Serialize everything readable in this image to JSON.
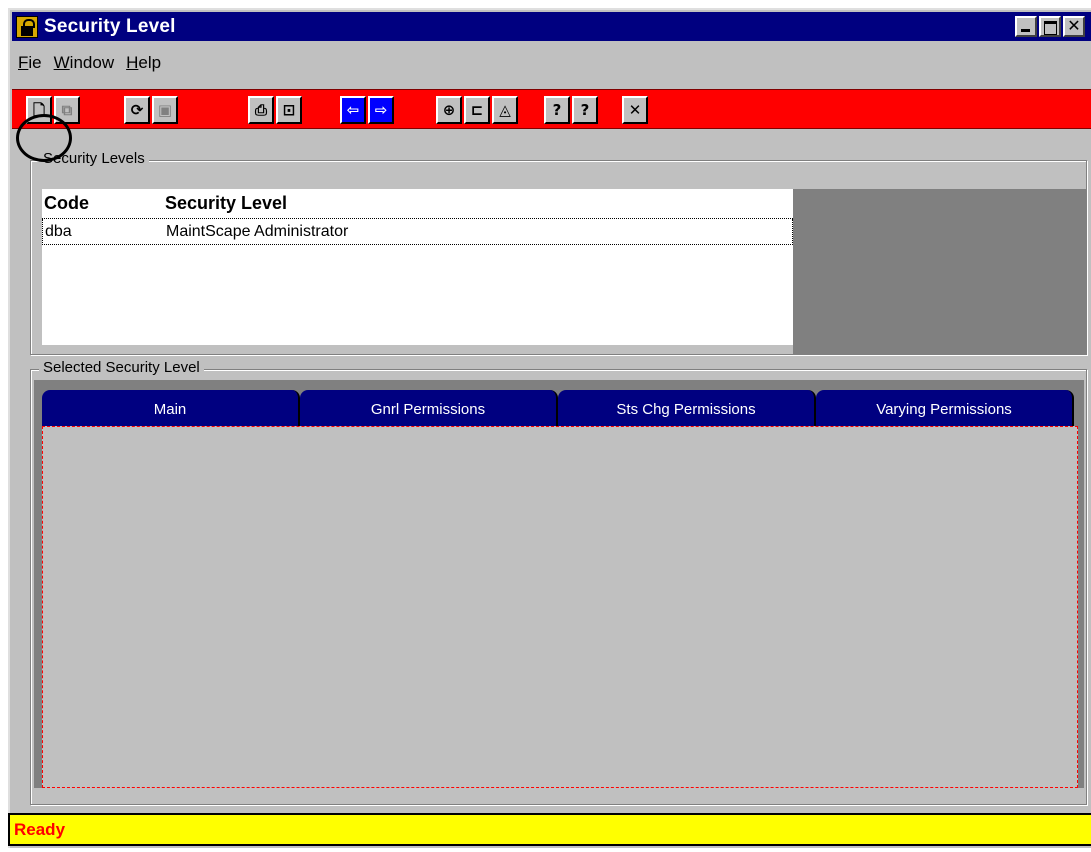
{
  "window": {
    "title": "Security Level",
    "icon": "lock-icon"
  },
  "menu": {
    "file": {
      "u": "F",
      "rest": "ie"
    },
    "window": {
      "u": "W",
      "rest": "indow"
    },
    "help": {
      "u": "H",
      "rest": "elp"
    }
  },
  "toolbar": {
    "buttons": [
      {
        "name": "new-document-icon"
      },
      {
        "name": "copy-icon"
      },
      {
        "name": "refresh-icon"
      },
      {
        "name": "save-icon"
      },
      {
        "name": "print-icon"
      },
      {
        "name": "print-preview-icon"
      },
      {
        "name": "previous-record-icon"
      },
      {
        "name": "next-record-icon"
      },
      {
        "name": "security-lock-icon"
      },
      {
        "name": "open-folder-icon"
      },
      {
        "name": "find-icon"
      },
      {
        "name": "help-icon"
      },
      {
        "name": "context-help-icon"
      },
      {
        "name": "close-icon"
      }
    ]
  },
  "security_levels": {
    "legend": "Security Levels",
    "columns": {
      "code": "Code",
      "level": "Security Level"
    },
    "rows": [
      {
        "code": "dba",
        "level": "MaintScape Administrator"
      }
    ]
  },
  "selected": {
    "legend": "Selected Security Level",
    "tabs": [
      "Main",
      "Gnrl Permissions",
      "Sts Chg Permissions",
      "Varying Permissions"
    ]
  },
  "status": {
    "text": "Ready"
  },
  "colors": {
    "title_bar": "#000080",
    "toolbar": "#ff0000",
    "status_bar": "#ffff00",
    "status_text": "#ff0000"
  }
}
